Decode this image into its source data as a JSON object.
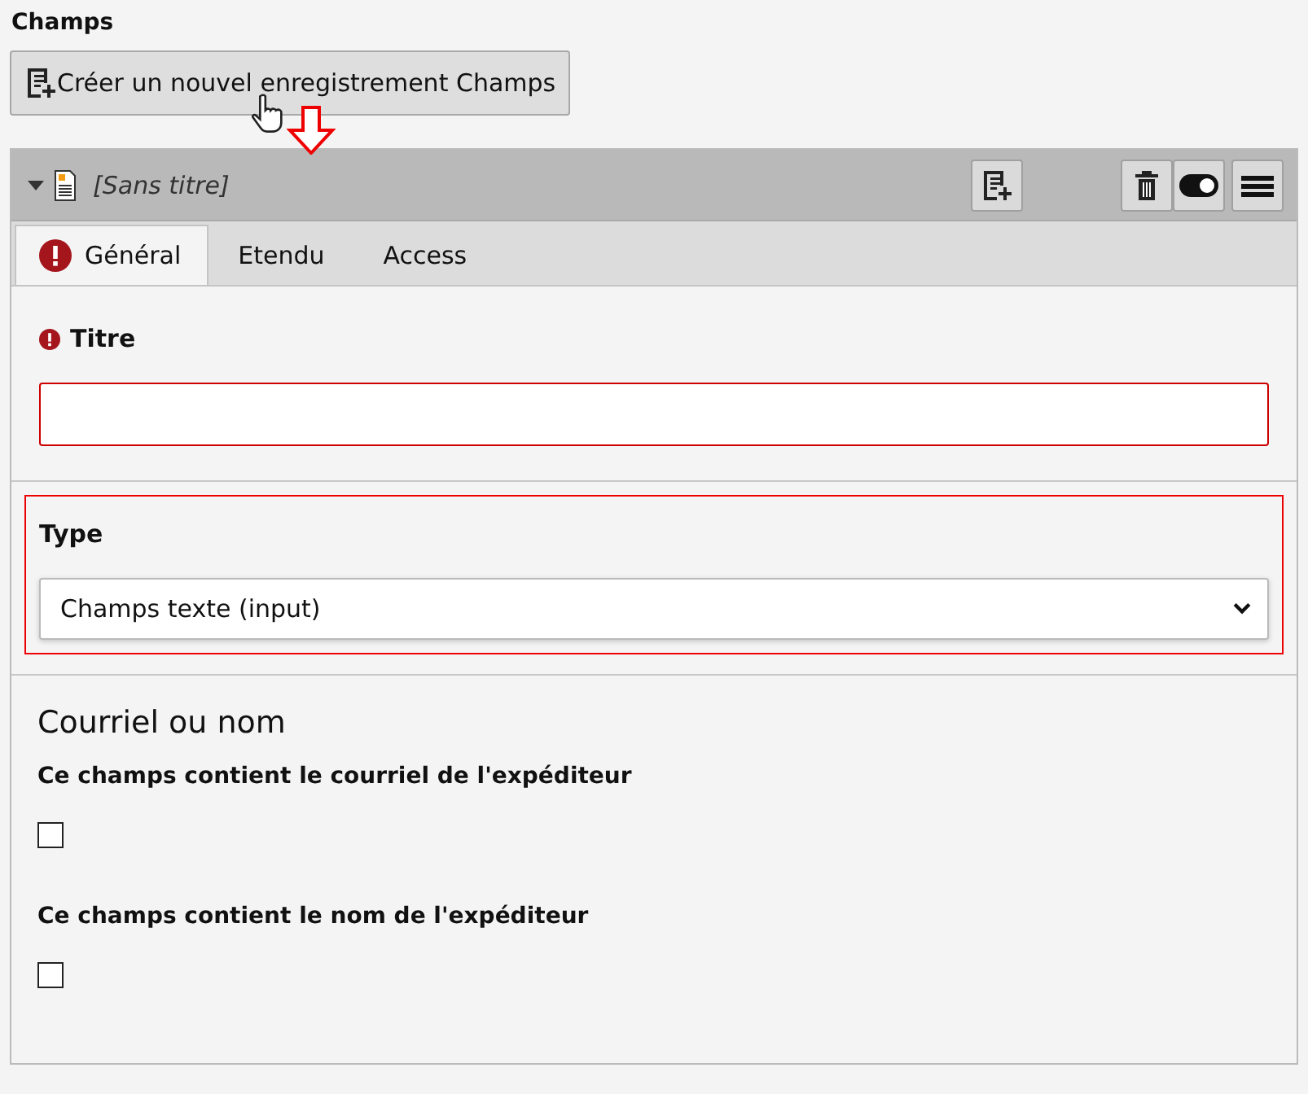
{
  "section_title": "Champs",
  "create_button": {
    "label": "Créer un nouvel enregistrement Champs"
  },
  "record": {
    "title": "[Sans titre]",
    "expanded": true
  },
  "tabs": [
    {
      "label": "Général",
      "selected": true,
      "error": true
    },
    {
      "label": "Etendu",
      "selected": false,
      "error": false
    },
    {
      "label": "Access",
      "selected": false,
      "error": false
    }
  ],
  "sections": [
    {
      "kind": "text",
      "label": "Titre",
      "error": true,
      "highlighted": false
    },
    {
      "kind": "select",
      "label": "Type",
      "error": false,
      "highlighted": true,
      "value": "Champs texte (input)"
    },
    {
      "kind": "group",
      "heading": "Courriel ou nom",
      "checkboxes": [
        {
          "label": "Ce champs contient le courriel de l'expéditeur",
          "checked": false
        },
        {
          "label": "Ce champs contient le nom de l'expéditeur",
          "checked": false
        }
      ]
    }
  ]
}
